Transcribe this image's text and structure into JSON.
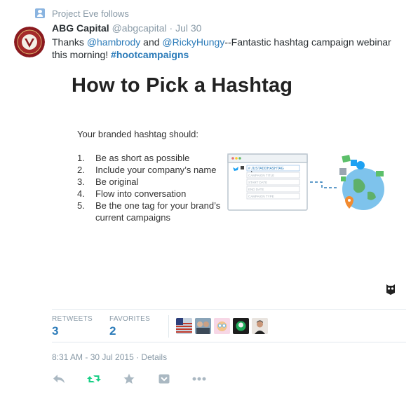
{
  "context": {
    "text": "Project Eve follows"
  },
  "tweet": {
    "author_name": "ABG Capital",
    "author_handle": "@abgcapital",
    "separator": "·",
    "date": "Jul 30",
    "text": {
      "prefix": "Thanks ",
      "mention1": "@hambrody",
      "and": " and ",
      "mention2": "@RickyHungy",
      "body": "--Fantastic hashtag campaign webinar this morning! ",
      "hashtag": "#hootcampaigns"
    }
  },
  "media": {
    "title": "How to Pick a Hashtag",
    "intro": "Your branded hashtag should:",
    "tips": [
      {
        "num": "1.",
        "text": "Be as short as possible"
      },
      {
        "num": "2.",
        "text": "Include your company’s name"
      },
      {
        "num": "3.",
        "text": "Be original"
      },
      {
        "num": "4.",
        "text": "Flow into conversation"
      },
      {
        "num": "5.",
        "text": "Be the one tag for your brand’s current campaigns"
      }
    ],
    "form": {
      "hashtag_field": "# JUSTADDHASHTAG",
      "fields": [
        "CAMPAIGN TITLE",
        "START DATE",
        "END DATE",
        "CAMPAIGN TYPE"
      ]
    }
  },
  "stats": {
    "retweets_label": "RETWEETS",
    "retweets_value": "3",
    "favorites_label": "FAVORITES",
    "favorites_value": "2"
  },
  "timestamp": {
    "time": "8:31 AM - 30 Jul 2015",
    "separator": " · ",
    "details": "Details"
  },
  "actions": [
    "reply-icon",
    "retweet-icon",
    "favorite-icon",
    "pocket-icon",
    "more-icon"
  ],
  "colors": {
    "link": "#2b7bb9",
    "muted": "#8899a6",
    "retweet_active": "#19cf86",
    "border": "#e1e8ed"
  }
}
